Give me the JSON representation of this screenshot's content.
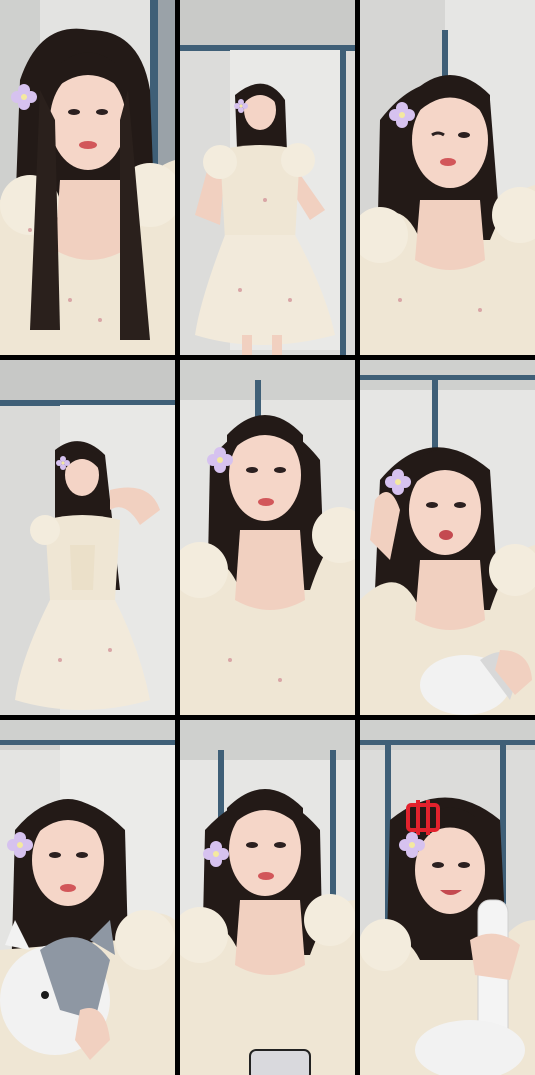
{
  "grid": {
    "rows": 3,
    "cols": 3,
    "background_color": "#000000"
  },
  "tiles": [
    {
      "shot": "close-up",
      "has_flower_clip": true,
      "holds": "none"
    },
    {
      "shot": "full-body",
      "has_flower_clip": true,
      "holds": "none"
    },
    {
      "shot": "close-up",
      "has_flower_clip": true,
      "holds": "none"
    },
    {
      "shot": "full-body",
      "has_flower_clip": true,
      "holds": "none"
    },
    {
      "shot": "close-up",
      "has_flower_clip": true,
      "holds": "none"
    },
    {
      "shot": "close-up",
      "has_flower_clip": true,
      "holds": "plush-toy"
    },
    {
      "shot": "close-up",
      "has_flower_clip": true,
      "holds": "plush-husky"
    },
    {
      "shot": "close-up",
      "has_flower_clip": true,
      "holds": "phone"
    },
    {
      "shot": "close-up",
      "has_flower_clip": true,
      "holds": "white-bottle"
    }
  ],
  "colors": {
    "wall": "#e2e2e0",
    "wall_shadow": "#b9bab8",
    "door_frame": "#3f5f77",
    "hair": "#231a17",
    "skin": "#f3d2c3",
    "dress": "#f1e8d6",
    "dress_print": "#d9a6a6",
    "flower": "#c9a9e6",
    "lips": "#d2575a",
    "plush_white": "#f2f2f2",
    "plush_gray": "#8e97a3",
    "red_ornament": "#e2222d"
  }
}
